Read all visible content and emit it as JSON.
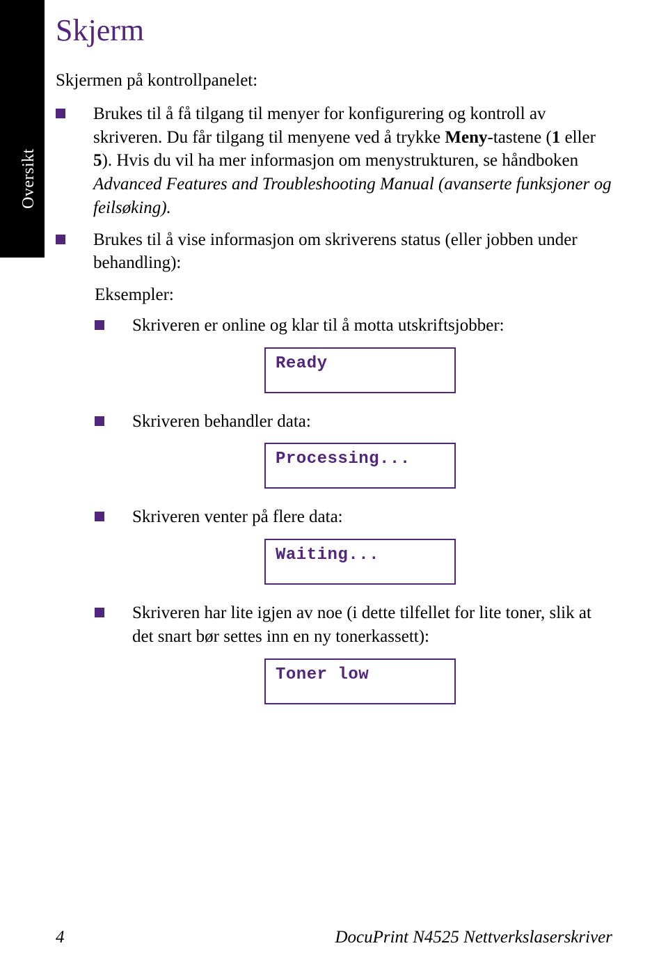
{
  "sideTab": "Oversikt",
  "title": "Skjerm",
  "intro": "Skjermen på kontrollpanelet:",
  "bullets": {
    "b1_pre": "Brukes til å få tilgang til menyer for konfigurering og kontroll av skriveren. Du får tilgang til menyene ved å trykke ",
    "b1_meny": "Meny",
    "b1_mid": "-tastene (",
    "b1_one": "1",
    "b1_or": " eller ",
    "b1_five": "5",
    "b1_post1": "). Hvis du vil ha mer informasjon om menystrukturen, se håndboken ",
    "b1_italic": "Advanced Features and Troubleshooting Manual (avanserte funksjoner og feilsøking).",
    "b2": "Brukes til å vise informasjon om skriverens status (eller jobben under behandling):",
    "examplesLabel": "Eksempler:",
    "ex1": "Skriveren er online og klar til å motta utskriftsjobber:",
    "ex2": "Skriveren behandler data:",
    "ex3": "Skriveren venter på flere data:",
    "ex4": "Skriveren har lite igjen av noe (i dette tilfellet for lite toner, slik at det snart bør settes inn en ny tonerkassett):"
  },
  "lcd": {
    "ready": "Ready",
    "processing": "Processing...",
    "waiting": "Waiting...",
    "tonerLow": "Toner low"
  },
  "footer": {
    "pageNum": "4",
    "product": "DocuPrint N4525 Nettverkslaserskriver"
  }
}
